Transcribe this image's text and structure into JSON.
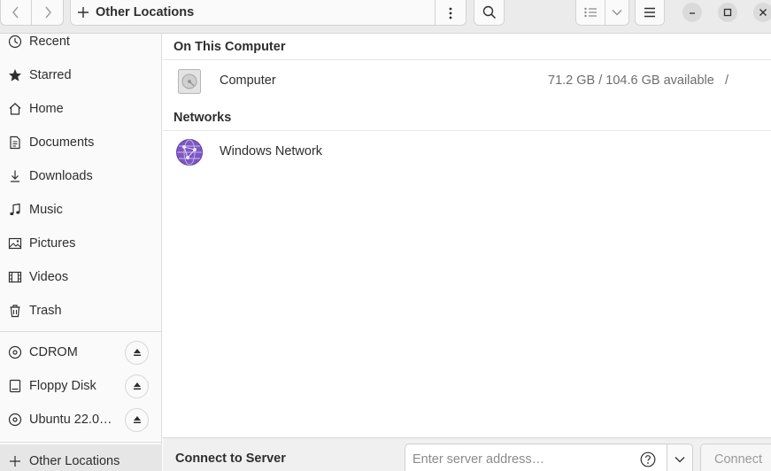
{
  "header": {
    "location": "Other Locations"
  },
  "sidebar": {
    "places": [
      {
        "label": "Recent",
        "icon": "recent-icon"
      },
      {
        "label": "Starred",
        "icon": "star-icon"
      },
      {
        "label": "Home",
        "icon": "home-icon"
      },
      {
        "label": "Documents",
        "icon": "documents-icon"
      },
      {
        "label": "Downloads",
        "icon": "downloads-icon"
      },
      {
        "label": "Music",
        "icon": "music-icon"
      },
      {
        "label": "Pictures",
        "icon": "pictures-icon"
      },
      {
        "label": "Videos",
        "icon": "videos-icon"
      },
      {
        "label": "Trash",
        "icon": "trash-icon"
      }
    ],
    "devices": [
      {
        "label": "CDROM",
        "icon": "disc-icon"
      },
      {
        "label": "Floppy Disk",
        "icon": "drive-icon"
      },
      {
        "label": "Ubuntu 22.0…",
        "icon": "disc-icon"
      }
    ],
    "other": {
      "label": "Other Locations",
      "icon": "plus-icon"
    }
  },
  "main": {
    "on_this_computer": "On This Computer",
    "computer": {
      "name": "Computer",
      "info": "71.2 GB / 104.6 GB available",
      "path": "/"
    },
    "networks": "Networks",
    "windows_network": {
      "name": "Windows Network"
    }
  },
  "actionbar": {
    "label": "Connect to Server",
    "placeholder": "Enter server address…",
    "connect": "Connect"
  },
  "colors": {
    "headerbar": "#ebebeb",
    "sidebar": "#fafafa",
    "network_icon": "#7e57c2"
  }
}
